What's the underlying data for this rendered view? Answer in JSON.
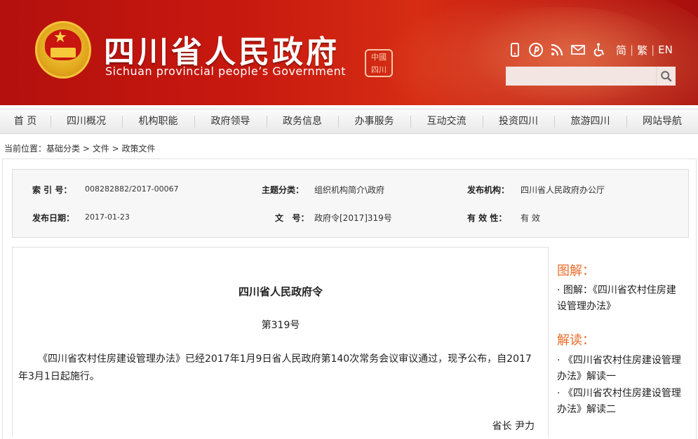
{
  "header": {
    "title": "四川省人民政府",
    "subtitle": "Sichuan provincial people’s Government",
    "seal_text": "中國四川",
    "tools": [
      "mobile-icon",
      "pinterest-icon",
      "rss-icon",
      "mail-icon",
      "accessibility-icon"
    ],
    "lang": {
      "simplified": "简",
      "traditional": "繁",
      "english": "EN",
      "separator": "|"
    },
    "search": {
      "placeholder": "",
      "value": ""
    },
    "colors": {
      "brand": "#c8190f",
      "accent": "#e96c2a"
    }
  },
  "nav": {
    "items": [
      {
        "label": "首 页"
      },
      {
        "label": "四川概况"
      },
      {
        "label": "机构职能"
      },
      {
        "label": "政府领导"
      },
      {
        "label": "政务信息"
      },
      {
        "label": "办事服务"
      },
      {
        "label": "互动交流"
      },
      {
        "label": "投资四川"
      },
      {
        "label": "旅游四川"
      },
      {
        "label": "网站导航"
      }
    ]
  },
  "breadcrumb": {
    "prefix": "当前位置：",
    "items": [
      "基础分类",
      "文件",
      "政策文件"
    ],
    "separator": ">"
  },
  "meta": {
    "index_label": "索 引 号：",
    "index_value": "008282882/2017-00067",
    "topic_label": "主题分类：",
    "topic_value": "组织机构简介\\政府",
    "issuer_label": "发布机构：",
    "issuer_value": "四川省人民政府办公厅",
    "date_label": "发布日期：",
    "date_value": "2017-01-23",
    "docno_label": "文   号：",
    "docno_value": "政府令[2017]319号",
    "validity_label": "有 效 性：",
    "validity_value": "有 效"
  },
  "document": {
    "title": "四川省人民政府令",
    "number": "第319号",
    "body": "《四川省农村住房建设管理办法》已经2017年1月9日省人民政府第140次常务会议审议通过，现予公布，自2017年3月1日起施行。",
    "signature": "省长 尹力"
  },
  "sidebar": {
    "graphic_heading": "图解：",
    "graphic_links": [
      "· 图解：《四川省农村住房建设管理办法》"
    ],
    "reading_heading": "解读：",
    "reading_links": [
      "· 《四川省农村住房建设管理办法》解读一",
      "· 《四川省农村住房建设管理办法》解读二"
    ]
  }
}
